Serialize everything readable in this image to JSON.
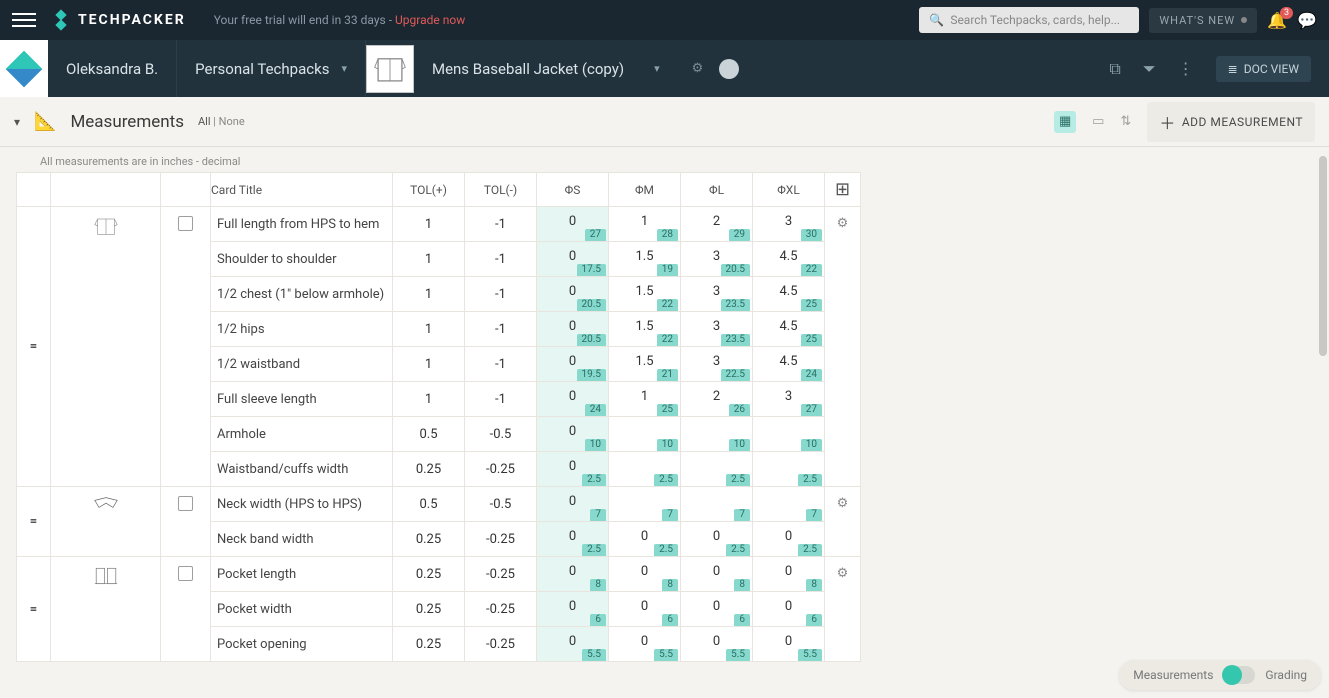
{
  "topbar": {
    "brand": "TECHPACKER",
    "trial_prefix": "Your free trial will end in 33 days - ",
    "upgrade": "Upgrade now",
    "search_placeholder": "Search Techpacks, cards, help...",
    "whats_new": "WHAT'S NEW",
    "notif_count": "3"
  },
  "nav": {
    "owner": "Oleksandra B.",
    "workspace": "Personal Techpacks",
    "techpack": "Mens Baseball Jacket (copy)",
    "doc_view": "DOC VIEW"
  },
  "section": {
    "title": "Measurements",
    "all": "All",
    "none": "None",
    "add": "ADD MEASUREMENT",
    "note": "All measurements are in inches - decimal"
  },
  "columns": {
    "card": "Card Title",
    "tolp": "TOL(+)",
    "tolm": "TOL(-)",
    "s": "ΦS",
    "m": "ΦM",
    "l": "ΦL",
    "xl": "ΦXL"
  },
  "groups": [
    {
      "thumb": "jacket",
      "rows": [
        {
          "title": "Full length from HPS to hem",
          "tp": "1",
          "tm": "-1",
          "s": {
            "v": "0",
            "t": "27"
          },
          "m": {
            "v": "1",
            "t": "28"
          },
          "l": {
            "v": "2",
            "t": "29"
          },
          "xl": {
            "v": "3",
            "t": "30"
          }
        },
        {
          "title": "Shoulder to shoulder",
          "tp": "1",
          "tm": "-1",
          "s": {
            "v": "0",
            "t": "17.5"
          },
          "m": {
            "v": "1.5",
            "t": "19"
          },
          "l": {
            "v": "3",
            "t": "20.5"
          },
          "xl": {
            "v": "4.5",
            "t": "22"
          }
        },
        {
          "title": "1/2 chest (1\" below armhole)",
          "tp": "1",
          "tm": "-1",
          "s": {
            "v": "0",
            "t": "20.5"
          },
          "m": {
            "v": "1.5",
            "t": "22"
          },
          "l": {
            "v": "3",
            "t": "23.5"
          },
          "xl": {
            "v": "4.5",
            "t": "25"
          }
        },
        {
          "title": "1/2 hips",
          "tp": "1",
          "tm": "-1",
          "s": {
            "v": "0",
            "t": "20.5"
          },
          "m": {
            "v": "1.5",
            "t": "22"
          },
          "l": {
            "v": "3",
            "t": "23.5"
          },
          "xl": {
            "v": "4.5",
            "t": "25"
          }
        },
        {
          "title": "1/2 waistband",
          "tp": "1",
          "tm": "-1",
          "s": {
            "v": "0",
            "t": "19.5"
          },
          "m": {
            "v": "1.5",
            "t": "21"
          },
          "l": {
            "v": "3",
            "t": "22.5"
          },
          "xl": {
            "v": "4.5",
            "t": "24"
          }
        },
        {
          "title": "Full sleeve length",
          "tp": "1",
          "tm": "-1",
          "s": {
            "v": "0",
            "t": "24"
          },
          "m": {
            "v": "1",
            "t": "25"
          },
          "l": {
            "v": "2",
            "t": "26"
          },
          "xl": {
            "v": "3",
            "t": "27"
          }
        },
        {
          "title": "Armhole",
          "tp": "0.5",
          "tm": "-0.5",
          "s": {
            "v": "0",
            "t": "10"
          },
          "m": {
            "v": "",
            "t": "10"
          },
          "l": {
            "v": "",
            "t": "10"
          },
          "xl": {
            "v": "",
            "t": "10"
          }
        },
        {
          "title": "Waistband/cuffs width",
          "tp": "0.25",
          "tm": "-0.25",
          "s": {
            "v": "0",
            "t": "2.5"
          },
          "m": {
            "v": "",
            "t": "2.5"
          },
          "l": {
            "v": "",
            "t": "2.5"
          },
          "xl": {
            "v": "",
            "t": "2.5"
          }
        }
      ]
    },
    {
      "thumb": "collar",
      "rows": [
        {
          "title": "Neck width (HPS to HPS)",
          "tp": "0.5",
          "tm": "-0.5",
          "s": {
            "v": "0",
            "t": "7"
          },
          "m": {
            "v": "",
            "t": "7"
          },
          "l": {
            "v": "",
            "t": "7"
          },
          "xl": {
            "v": "",
            "t": "7"
          }
        },
        {
          "title": "Neck band width",
          "tp": "0.25",
          "tm": "-0.25",
          "s": {
            "v": "0",
            "t": "2.5"
          },
          "m": {
            "v": "0",
            "t": "2.5"
          },
          "l": {
            "v": "0",
            "t": "2.5"
          },
          "xl": {
            "v": "0",
            "t": "2.5"
          }
        }
      ]
    },
    {
      "thumb": "pocket",
      "rows": [
        {
          "title": "Pocket length",
          "tp": "0.25",
          "tm": "-0.25",
          "s": {
            "v": "0",
            "t": "8"
          },
          "m": {
            "v": "0",
            "t": "8"
          },
          "l": {
            "v": "0",
            "t": "8"
          },
          "xl": {
            "v": "0",
            "t": "8"
          }
        },
        {
          "title": "Pocket width",
          "tp": "0.25",
          "tm": "-0.25",
          "s": {
            "v": "0",
            "t": "6"
          },
          "m": {
            "v": "0",
            "t": "6"
          },
          "l": {
            "v": "0",
            "t": "6"
          },
          "xl": {
            "v": "0",
            "t": "6"
          }
        },
        {
          "title": "Pocket opening",
          "tp": "0.25",
          "tm": "-0.25",
          "s": {
            "v": "0",
            "t": "5.5"
          },
          "m": {
            "v": "0",
            "t": "5.5"
          },
          "l": {
            "v": "0",
            "t": "5.5"
          },
          "xl": {
            "v": "0",
            "t": "5.5"
          }
        }
      ]
    }
  ],
  "toggle": {
    "left": "Measurements",
    "right": "Grading"
  }
}
